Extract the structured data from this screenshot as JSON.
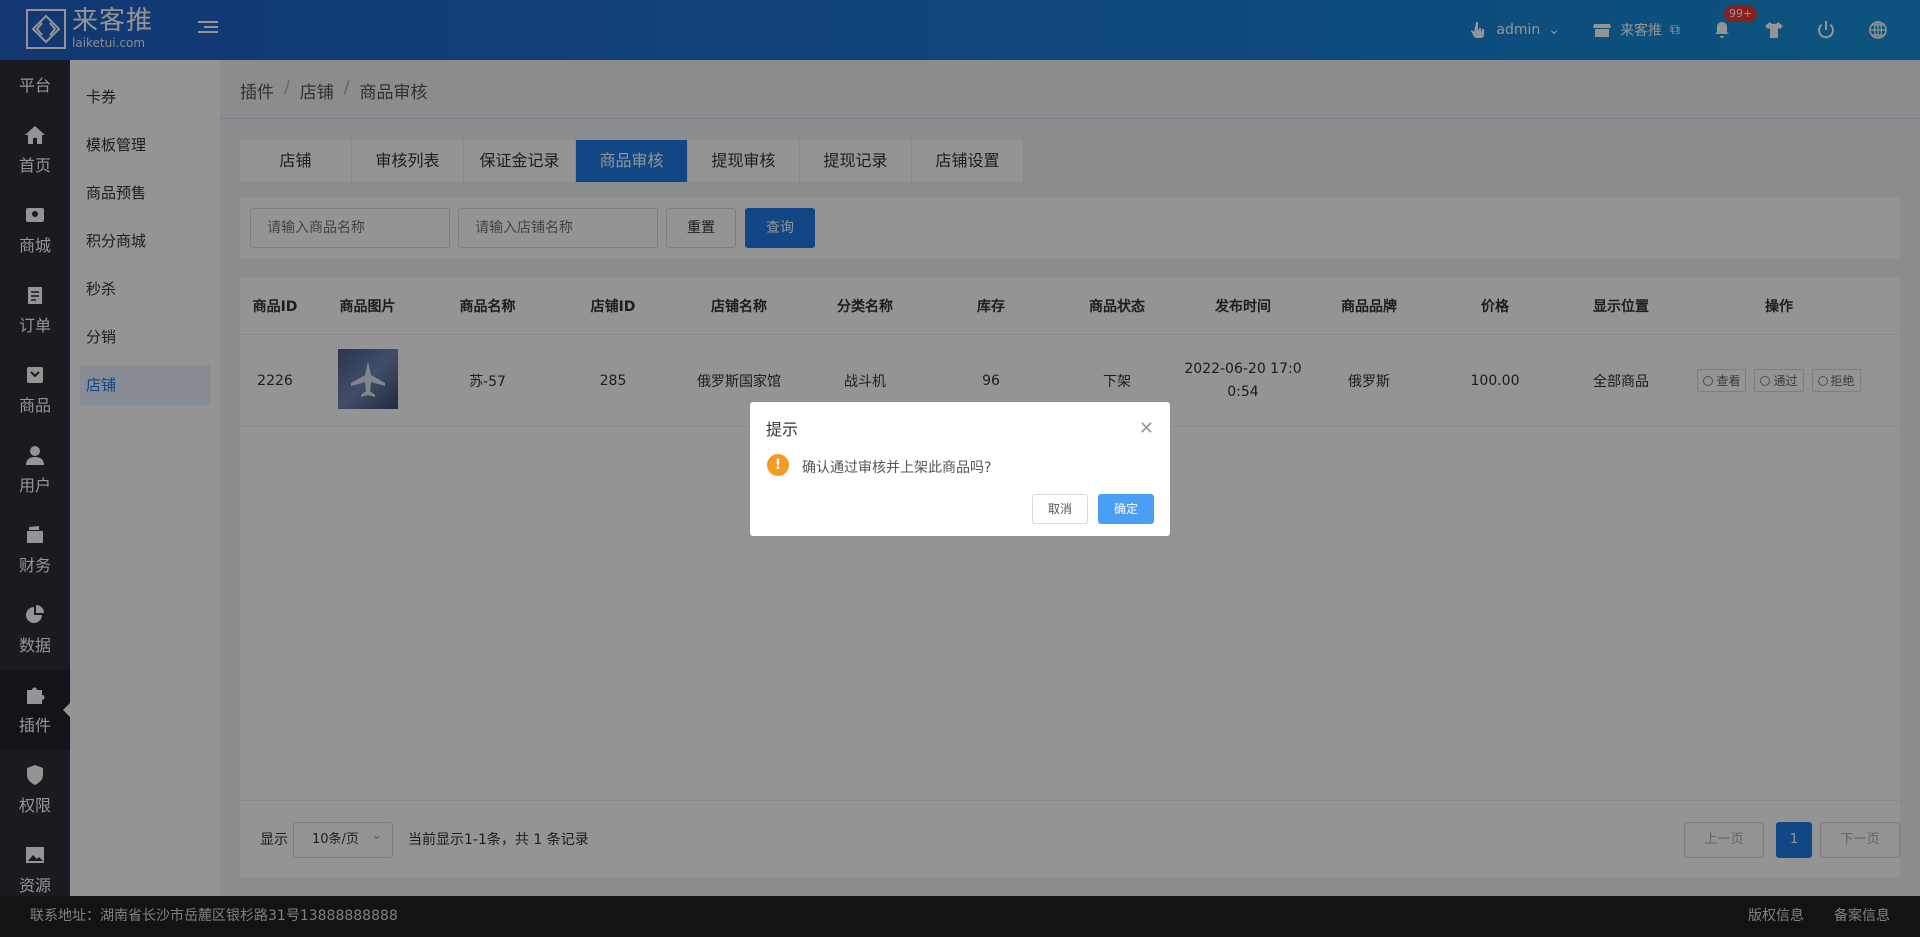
{
  "header": {
    "logo_cn": "来客推",
    "logo_en": "laiketui.com",
    "user": "admin",
    "store_link": "来客推",
    "notification_count": "99+"
  },
  "nav": [
    {
      "label": "平台",
      "icon": "platform-icon"
    },
    {
      "label": "首页",
      "icon": "home-icon"
    },
    {
      "label": "商城",
      "icon": "store-icon"
    },
    {
      "label": "订单",
      "icon": "order-icon"
    },
    {
      "label": "商品",
      "icon": "goods-icon"
    },
    {
      "label": "用户",
      "icon": "user-icon"
    },
    {
      "label": "财务",
      "icon": "wallet-icon"
    },
    {
      "label": "数据",
      "icon": "pie-chart-icon"
    },
    {
      "label": "插件",
      "icon": "puzzle-icon",
      "active": true
    },
    {
      "label": "权限",
      "icon": "shield-icon"
    },
    {
      "label": "资源",
      "icon": "image-icon"
    }
  ],
  "submenu": [
    "卡券",
    "模板管理",
    "商品预售",
    "积分商城",
    "秒杀",
    "分销",
    "店铺"
  ],
  "breadcrumb": [
    "插件",
    "店铺",
    "商品审核"
  ],
  "tabs": [
    "店铺",
    "审核列表",
    "保证金记录",
    "商品审核",
    "提现审核",
    "提现记录",
    "店铺设置"
  ],
  "filters": {
    "goods_name_placeholder": "请输入商品名称",
    "store_name_placeholder": "请输入店铺名称",
    "reset": "重置",
    "query": "查询"
  },
  "table": {
    "headers": [
      "商品ID",
      "商品图片",
      "商品名称",
      "店铺ID",
      "店铺名称",
      "分类名称",
      "库存",
      "商品状态",
      "发布时间",
      "商品品牌",
      "价格",
      "显示位置",
      "操作"
    ],
    "rows": [
      {
        "id": "2226",
        "name": "苏-57",
        "store_id": "285",
        "store_name": "俄罗斯国家馆",
        "category": "战斗机",
        "stock": "96",
        "status": "下架",
        "time_line1": "2022-06-20 17:0",
        "time_line2": "0:54",
        "brand": "俄罗斯",
        "price": "100.00",
        "position": "全部商品",
        "ops": {
          "view": "查看",
          "approve": "通过",
          "reject": "拒绝"
        }
      }
    ]
  },
  "pager": {
    "show_label": "显示",
    "page_size": "10条/页",
    "info": "当前显示1-1条，共 1 条记录",
    "prev": "上一页",
    "current": "1",
    "next": "下一页"
  },
  "footer": {
    "address": "联系地址：湖南省长沙市岳麓区银杉路31号13888888888",
    "copyright": "版权信息",
    "record": "备案信息"
  },
  "dialog": {
    "title": "提示",
    "message": "确认通过审核并上架此商品吗?",
    "cancel": "取消",
    "confirm": "确定"
  }
}
